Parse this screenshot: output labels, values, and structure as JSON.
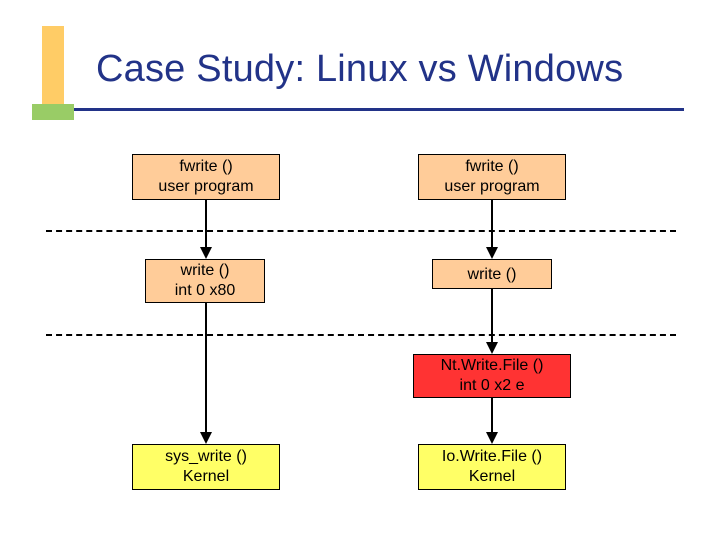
{
  "title": "Case Study: Linux vs Windows",
  "linux": {
    "user": "fwrite ()\nuser program",
    "libc": "write ()\nint 0 x80",
    "kernel": "sys_write ()\nKernel"
  },
  "windows": {
    "user": "fwrite ()\nuser program",
    "lib": "write ()",
    "nt": "Nt.Write.File ()\nint 0 x2 e",
    "kernel": "Io.Write.File ()\nKernel"
  }
}
